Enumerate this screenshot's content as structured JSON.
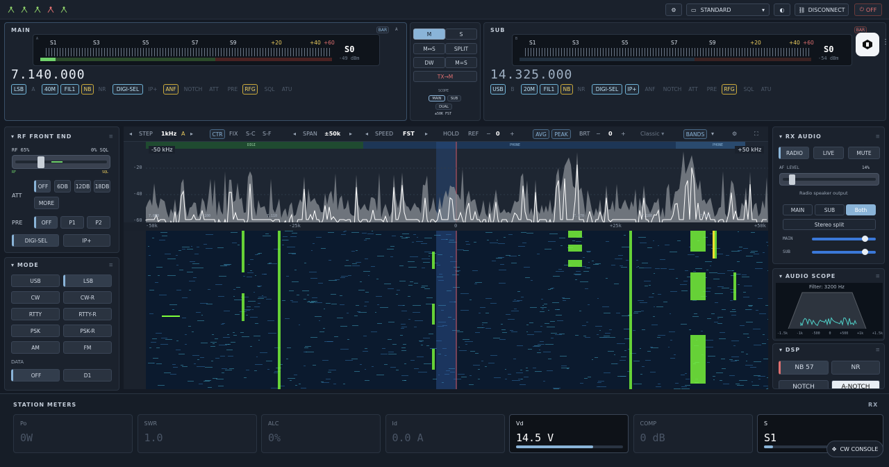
{
  "topbar": {
    "profile": "STANDARD",
    "disconnect": "DISCONNECT",
    "power": "OFF"
  },
  "main": {
    "title": "MAIN",
    "bar_badge": "BAR",
    "vfo_letter": "A",
    "scale": [
      "S1",
      "S3",
      "S5",
      "S7",
      "S9",
      "+20",
      "+40",
      "+60"
    ],
    "s_value": "S0",
    "dbm": "-49 dBm",
    "freq": "7.140.000",
    "buttons": [
      "LSB",
      "A",
      "40M",
      "FIL1",
      "NB",
      "NR",
      "DIGI-SEL",
      "IP+",
      "ANF",
      "NOTCH",
      "ATT",
      "PRE",
      "RFG",
      "SQL",
      "ATU"
    ]
  },
  "sub": {
    "title": "SUB",
    "bar_badge": "BAR",
    "vfo_letter": "B",
    "scale": [
      "S1",
      "S3",
      "S5",
      "S7",
      "S9",
      "+20",
      "+40",
      "+60"
    ],
    "s_value": "S0",
    "dbm": "-54 dBm",
    "freq": "14.325.000",
    "buttons": [
      "USB",
      "B",
      "20M",
      "FIL1",
      "NB",
      "NR",
      "DIGI-SEL",
      "IP+",
      "ANF",
      "NOTCH",
      "ATT",
      "PRE",
      "RFG",
      "SQL",
      "ATU"
    ]
  },
  "center": {
    "m": "M",
    "s": "S",
    "m_s": "M↔S",
    "split": "SPLIT",
    "dw": "DW",
    "m_eq_s": "M=S",
    "tx_m": "TX→M",
    "scope": "SCOPE",
    "scope_main": "MAIN",
    "scope_sub": "SUB",
    "dual": "DUAL",
    "span_fst": "±50K FST",
    "extra": "SCRL"
  },
  "rf": {
    "title": "RF FRONT END",
    "rf_label": "RF 65%",
    "sql_label": "0% SQL",
    "rf_short": "RF",
    "sql_short": "SQL",
    "att_label": "ATT",
    "att": [
      "OFF",
      "6DB",
      "12DB",
      "18DB",
      "MORE"
    ],
    "pre_label": "PRE",
    "pre": [
      "OFF",
      "P1",
      "P2"
    ],
    "digisel": "DIGI-SEL",
    "ipplus": "IP+"
  },
  "mode": {
    "title": "MODE",
    "modes": [
      "USB",
      "LSB",
      "CW",
      "CW-R",
      "RTTY",
      "RTTY-R",
      "PSK",
      "PSK-R",
      "AM",
      "FM"
    ],
    "data_label": "DATA",
    "data": [
      "OFF",
      "D1"
    ]
  },
  "toolbar": {
    "step_label": "STEP",
    "step": "1kHz",
    "step_a": "A",
    "ctr": "CTR",
    "fix": "FIX",
    "sc": "S-C",
    "sf": "S-F",
    "span_label": "SPAN",
    "span": "±50k",
    "speed_label": "SPEED",
    "speed": "FST",
    "hold": "HOLD",
    "ref_label": "REF",
    "ref": "0",
    "avg": "AVG",
    "peak": "PEAK",
    "brt_label": "BRT",
    "brt": "0",
    "theme": "Classic",
    "bands": "BANDS"
  },
  "spectrum": {
    "left_edge": "-50 kHz",
    "right_edge": "+50 kHz",
    "band_digi": "DIGI",
    "band_phone": "PHONE",
    "band_phone2": "PHONE",
    "db_ticks": [
      "-20",
      "-40",
      "-60"
    ],
    "freq_ticks": [
      "-50k",
      "-25k",
      "0",
      "+25k",
      "+50k"
    ],
    "inner_marks": [
      "7.090",
      "7.100",
      "7.110",
      "7.170",
      "7.180",
      "7.190"
    ]
  },
  "rxaudio": {
    "title": "RX AUDIO",
    "routes": [
      "RADIO",
      "LIVE",
      "MUTE"
    ],
    "af_label": "AF LEVEL",
    "af_value": "14%",
    "af_fraction": 0.14,
    "speaker": "Radio speaker output",
    "outputs": [
      "MAIN",
      "SUB",
      "Both"
    ],
    "stereo": "Stereo split",
    "main_label": "MAIN",
    "sub_label": "SUB"
  },
  "scope": {
    "title": "AUDIO SCOPE",
    "filter": "Filter: 3200 Hz",
    "axis": [
      "-1.5k",
      "-1k",
      "-500",
      "0",
      "+500",
      "+1k",
      "+1.5k"
    ]
  },
  "dsp": {
    "title": "DSP",
    "buttons": [
      "NB 57",
      "NR",
      "NOTCH",
      "A-NOTCH"
    ]
  },
  "meters": {
    "title": "STATION METERS",
    "rx": "RX",
    "cards": [
      {
        "label": "Po",
        "value": "0W"
      },
      {
        "label": "SWR",
        "value": "1.0"
      },
      {
        "label": "ALC",
        "value": "0%"
      },
      {
        "label": "Id",
        "value": "0.0 A"
      },
      {
        "label": "Vd",
        "value": "14.5 V",
        "fill": 0.72
      },
      {
        "label": "COMP",
        "value": "0 dB"
      },
      {
        "label": "S",
        "value": "S1",
        "fill": 0.08
      }
    ],
    "cw_console": "CW CONSOLE"
  },
  "colors": {
    "accent": "#8ab4d8",
    "yellow": "#f0d060",
    "waterfall_bg": "#0c2a4a",
    "signal_green": "#7dff3a",
    "power_off": "#e07070"
  }
}
